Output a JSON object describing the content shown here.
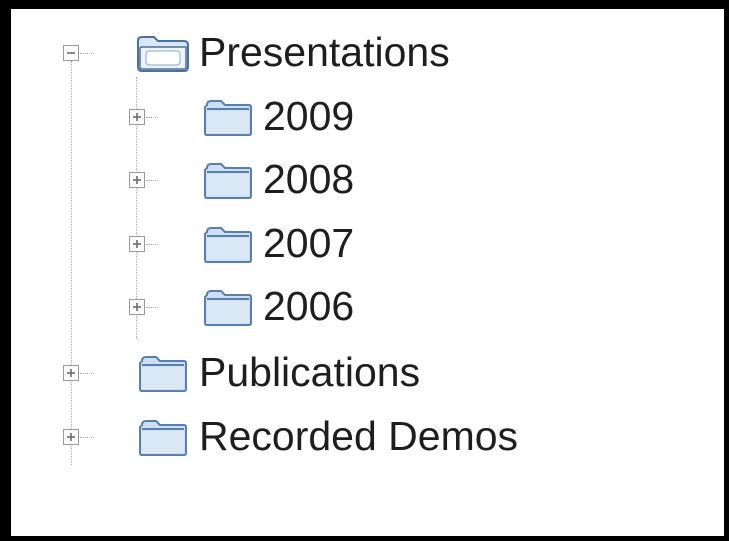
{
  "tree": {
    "root": {
      "label": "Presentations",
      "expanded": true,
      "children": [
        {
          "label": "2009",
          "expanded": false
        },
        {
          "label": "2008",
          "expanded": false
        },
        {
          "label": "2007",
          "expanded": false
        },
        {
          "label": "2006",
          "expanded": false
        }
      ]
    },
    "siblings": [
      {
        "label": "Publications",
        "expanded": false
      },
      {
        "label": "Recorded Demos",
        "expanded": false
      }
    ]
  },
  "colors": {
    "folder_fill": "#cfdff2",
    "folder_stroke": "#5a7fae",
    "text": "#1e1e1e",
    "connector": "#a8a8a8"
  },
  "icons": {
    "expanded_toggle": "minus-box-icon",
    "collapsed_toggle": "plus-box-icon",
    "open_folder": "folder-open-icon",
    "closed_folder": "folder-icon"
  }
}
